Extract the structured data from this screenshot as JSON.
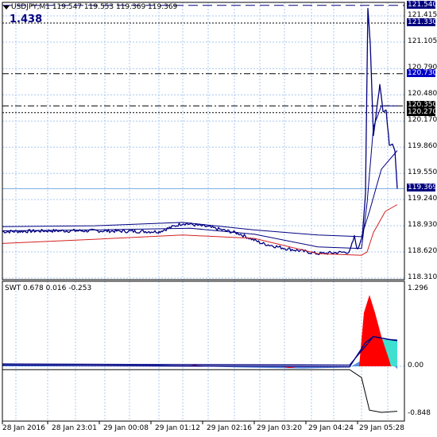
{
  "header": {
    "symbol_info": "USDJPY,M1  119.547 119.553 119.369 119.369",
    "big_value": "1.438",
    "indicator_info": "SWT 0.678 0.016 -0.253"
  },
  "colors": {
    "background": "#ffffff",
    "grid": "#a8c8f0",
    "price_line": "#000080",
    "ma_fast": "#000080",
    "ma_slow": "#d42020",
    "hist_red": "#ff0000",
    "hist_cyan": "#40e0d0",
    "hist_blue": "#5a8fe0"
  },
  "price_axis": {
    "labels": [
      "121.415",
      "121.105",
      "120.790",
      "120.480",
      "120.170",
      "119.860",
      "119.550",
      "119.240",
      "118.930",
      "118.620",
      "118.310"
    ],
    "markers": [
      {
        "value": "121.540",
        "style": "navy"
      },
      {
        "value": "121.330",
        "style": "navy"
      },
      {
        "value": "120.730",
        "style": "blue"
      },
      {
        "value": "120.350",
        "style": "black"
      },
      {
        "value": "120.270",
        "style": "black"
      },
      {
        "value": "119.369",
        "style": "navy"
      }
    ]
  },
  "indicator_axis": {
    "labels": [
      "1.296",
      "0.00",
      "-0.848"
    ]
  },
  "time_axis": {
    "labels": [
      "28 Jan 2016",
      "28 Jan 23:01",
      "29 Jan 00:08",
      "29 Jan 01:12",
      "29 Jan 02:16",
      "29 Jan 03:20",
      "29 Jan 04:24",
      "29 Jan 05:28"
    ]
  },
  "chart_data": {
    "type": "line",
    "symbol": "USDJPY",
    "timeframe": "M1",
    "price_range": [
      118.31,
      121.54
    ],
    "price_series_approx": [
      {
        "t": "28 Jan 2016",
        "price": 118.87
      },
      {
        "t": "28 Jan 23:01",
        "price": 118.88
      },
      {
        "t": "29 Jan 00:08",
        "price": 118.87
      },
      {
        "t": "29 Jan 01:12",
        "price": 118.95
      },
      {
        "t": "29 Jan 02:16",
        "price": 118.84
      },
      {
        "t": "29 Jan 03:20",
        "price": 118.66
      },
      {
        "t": "29 Jan 04:24",
        "price": 118.6
      },
      {
        "t": "29 Jan 05:28",
        "price": 120.5
      }
    ],
    "high": 121.415,
    "last": 119.369,
    "indicator": {
      "name": "SWT",
      "values": [
        0.678,
        0.016,
        -0.253
      ],
      "range": [
        -0.848,
        1.296
      ]
    }
  }
}
